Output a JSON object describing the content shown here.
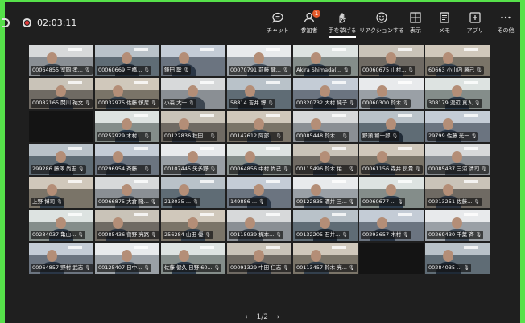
{
  "meeting": {
    "timer": "02:03:11"
  },
  "toolbar": [
    {
      "label": "チャット",
      "icon": "chat-icon"
    },
    {
      "label": "参加者",
      "icon": "people-icon",
      "badge": "1"
    },
    {
      "label": "手を挙げる",
      "icon": "raise-hand-icon",
      "active": true
    },
    {
      "label": "リアクションする",
      "icon": "reaction-icon"
    },
    {
      "label": "表示",
      "icon": "view-grid-icon"
    },
    {
      "label": "メモ",
      "icon": "notes-icon"
    },
    {
      "label": "アプリ",
      "icon": "apps-icon"
    },
    {
      "label": "その他",
      "icon": "more-icon"
    }
  ],
  "participants": [
    "00064855 室岡 孝...",
    "00060669 三橋...",
    "鎌田 聡",
    "00070791 前藤 健...",
    "Akira Shimada(...",
    "00060675 山村...",
    "60663 小山内 勝己",
    "00082165 関川 祐文",
    "00032975 佐藤 慎尼",
    "小森 大一",
    "58814 吉井 博",
    "00320732 大村 純子",
    "00060300 鈴木",
    "308179 渡辺 真人",
    "",
    "00252929 木村...",
    "00122836 秋田...",
    "00147612 阿部...",
    "00085448 鈴木...",
    "野瀬 和一郎",
    "29799 佐藤 光一",
    "299286 藤澤 尚志",
    "00296954 斉藤...",
    "00107445 矢多野",
    "00064856 中村 尚己",
    "00115496 鈴木 佑...",
    "00061156 森井 良貴",
    "00085437 三浦 清司",
    "上野 博司",
    "00066875 大倉 隆...",
    "213035 ...",
    "149886 ...",
    "00122835 酒井 三...",
    "00060677 ...",
    "00213251 佐藤...",
    "00284037 亀山...",
    "00085436 菅野 亮路",
    "256284 山田 優",
    "00115939 梶本...",
    "00132205 石井...",
    "00293657 木村",
    "00269430 千葉 斉",
    "00064857 野村 武志",
    "00125407 日中...",
    "佐藤 健久 日野 60...",
    "00091329 中田 仁志",
    "00113457 鈴木 亮...",
    "",
    "00284035 ..."
  ],
  "pager": {
    "text": "1/2",
    "prev": "‹",
    "next": "›"
  },
  "colors": {
    "background": "#1f1f1f",
    "frame": "#56e14a",
    "badge": "#e55a2b",
    "recording": "#e03b3b"
  }
}
